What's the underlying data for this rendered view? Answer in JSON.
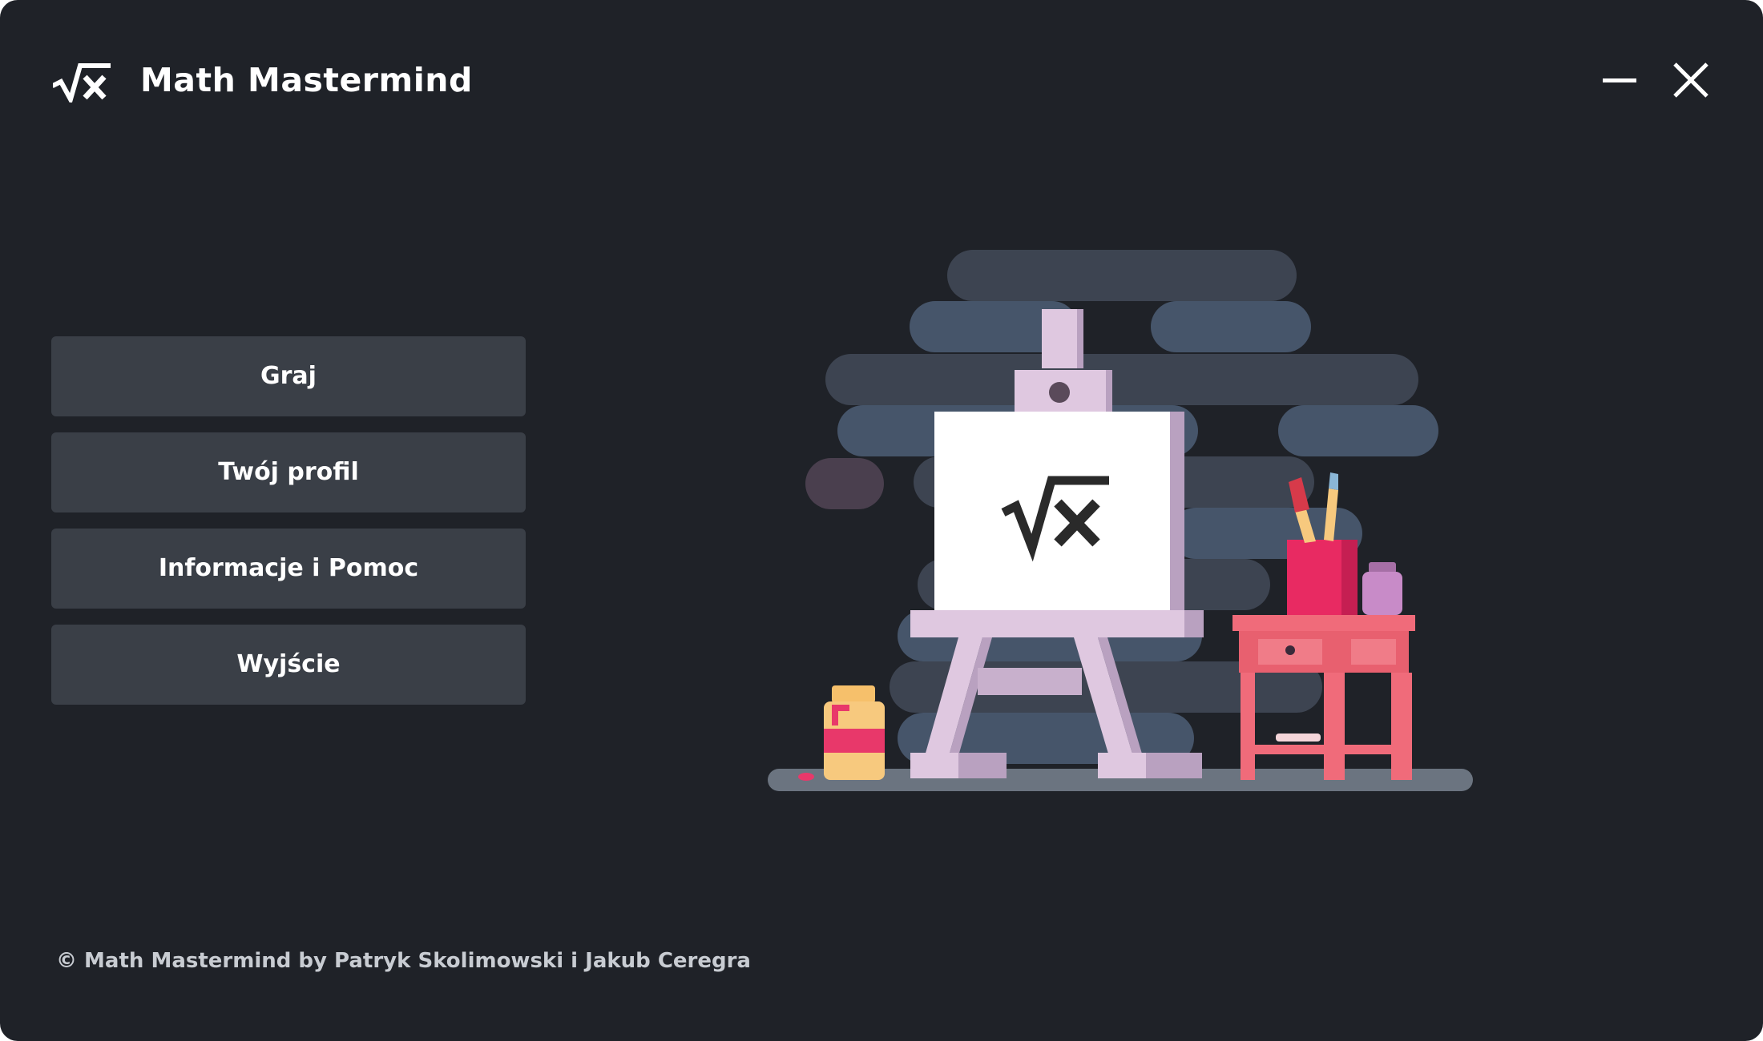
{
  "app": {
    "title": "Math Mastermind",
    "logo_icon": "sqrt-x-icon"
  },
  "window_controls": {
    "minimize_icon": "minimize-icon",
    "close_icon": "close-icon"
  },
  "menu": {
    "items": [
      {
        "label": "Graj"
      },
      {
        "label": "Twój profil"
      },
      {
        "label": "Informacje i Pomoc"
      },
      {
        "label": "Wyjście"
      }
    ]
  },
  "footer": {
    "copyright": "© Math Mastermind by Patryk Skolimowski i Jakub Ceregra"
  },
  "colors": {
    "background": "#1f2228",
    "button": "#3a3f47",
    "text": "#ffffff"
  }
}
